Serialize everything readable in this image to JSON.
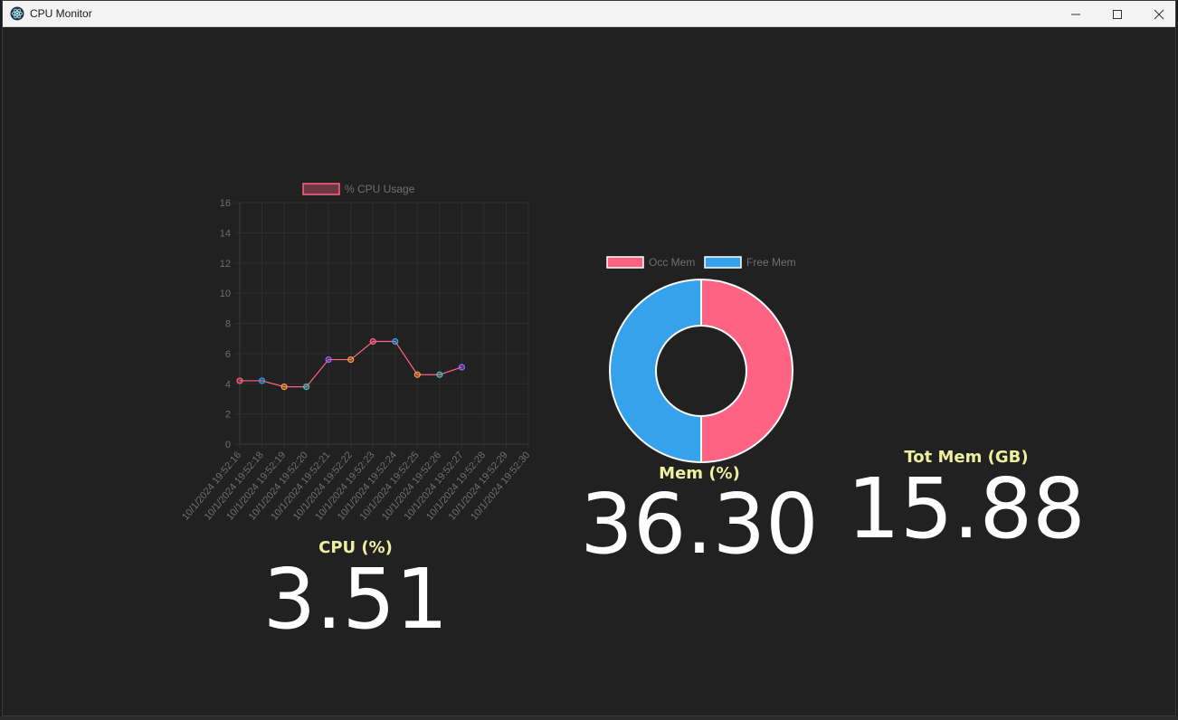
{
  "window": {
    "title": "CPU Monitor",
    "controls": [
      "minimize",
      "maximize",
      "close"
    ]
  },
  "cpu": {
    "label": "CPU (%)",
    "value": "3.51"
  },
  "mem": {
    "label": "Mem (%)",
    "value": "36.30"
  },
  "tot_mem": {
    "label": "Tot Mem (GB)",
    "value": "15.88"
  },
  "chart_data": [
    {
      "type": "line",
      "legend": [
        "% CPU Usage"
      ],
      "x": [
        "10/1/2024 19:52:16",
        "10/1/2024 19:52:18",
        "10/1/2024 19:52:19",
        "10/1/2024 19:52:20",
        "10/1/2024 19:52:21",
        "10/1/2024 19:52:22",
        "10/1/2024 19:52:23",
        "10/1/2024 19:52:24",
        "10/1/2024 19:52:25",
        "10/1/2024 19:52:26",
        "10/1/2024 19:52:27",
        "10/1/2024 19:52:28",
        "10/1/2024 19:52:29",
        "10/1/2024 19:52:30"
      ],
      "series": [
        {
          "name": "% CPU Usage",
          "values": [
            4.2,
            4.2,
            3.8,
            3.8,
            5.6,
            5.6,
            6.8,
            6.8,
            4.6,
            4.6,
            5.1
          ]
        }
      ],
      "yticks": [
        0,
        2,
        4,
        6,
        8,
        10,
        12,
        14,
        16
      ],
      "ylim": [
        0,
        16
      ],
      "grid": true,
      "legend_position": "top",
      "point_colors": [
        "#ff6384",
        "#36a2eb",
        "#ff9f40",
        "#4bc0c0",
        "#9966ff",
        "#ff9f40",
        "#ff6384",
        "#36a2eb",
        "#ff9f40",
        "#4bc0c0",
        "#9966ff"
      ],
      "line_color": "#ff6384"
    },
    {
      "type": "pie",
      "variant": "doughnut",
      "legend_position": "top",
      "series": [
        {
          "name": "Occ Mem",
          "value": 50,
          "color": "#ff6384"
        },
        {
          "name": "Free Mem",
          "value": 50,
          "color": "#36a2eb"
        }
      ]
    }
  ]
}
